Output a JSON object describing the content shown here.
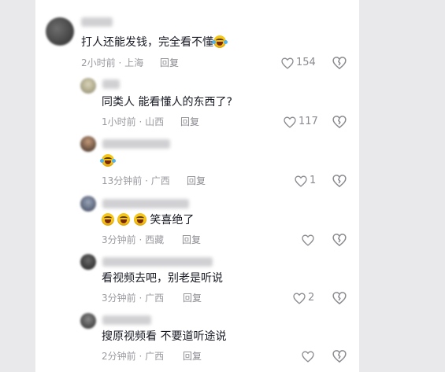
{
  "comments": [
    {
      "text": "打人还能发钱，完全看不懂",
      "time": "2小时前",
      "location": "上海",
      "reply": "回复",
      "likes": "154"
    },
    {
      "text": "同类人 能看懂人的东西了?",
      "time": "1小时前",
      "location": "山西",
      "reply": "回复",
      "likes": "117"
    },
    {
      "time": "13分钟前",
      "location": "广西",
      "reply": "回复",
      "likes": "1"
    },
    {
      "text_suffix": "笑喜绝了",
      "time": "3分钟前",
      "location": "西藏",
      "reply": "回复",
      "likes": ""
    },
    {
      "text": "看视频去吧，别老是听说",
      "time": "3分钟前",
      "location": "广西",
      "reply": "回复",
      "likes": "2"
    },
    {
      "text": "搜原视频看 不要道听途说",
      "time": "2分钟前",
      "location": "广西",
      "reply": "回复",
      "likes": ""
    }
  ],
  "icons": {
    "like": "heart-outline-icon",
    "dislike": "broken-heart-icon"
  }
}
